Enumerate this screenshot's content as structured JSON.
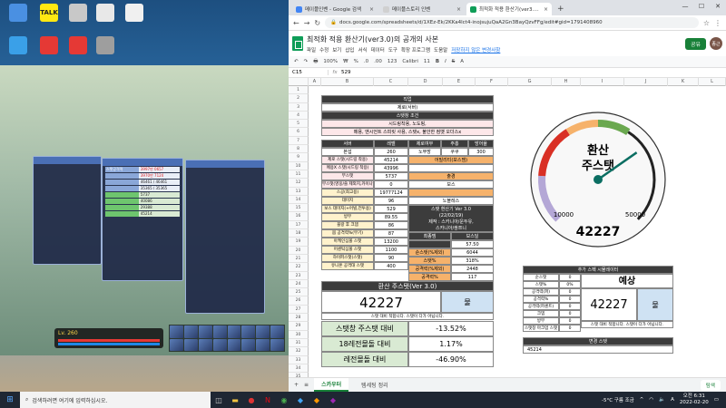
{
  "desktop": {
    "icons": [
      {
        "label": "",
        "color": "#4a90e2"
      },
      {
        "label": "TALK",
        "color": "#ffe812"
      },
      {
        "label": "",
        "color": "#c8c8c8"
      },
      {
        "label": "",
        "color": "#e8e8e8"
      },
      {
        "label": "",
        "color": "#f0f0f0"
      },
      {
        "label": "",
        "color": "#3aa0e8"
      },
      {
        "label": "",
        "color": "#e53935"
      },
      {
        "label": "",
        "color": "#e53935"
      },
      {
        "label": "",
        "color": "#9e9e9e"
      }
    ]
  },
  "game": {
    "level": "Lv. 260",
    "player_name": "",
    "stat_rows": [
      {
        "k": "스탯공격력",
        "v": "3997만 0657"
      },
      {
        "k": "",
        "v": "3970만 7124"
      },
      {
        "k": "",
        "v": "46461 / 46461"
      },
      {
        "k": "",
        "v": "35365 / 35365"
      },
      {
        "k": "",
        "v": "5737"
      },
      {
        "k": "",
        "v": "40086"
      },
      {
        "k": "",
        "v": "29388"
      },
      {
        "k": "",
        "v": "45214"
      }
    ]
  },
  "browser": {
    "tabs": [
      {
        "label": "메이플인벤 - Google 검색",
        "color": "#4285f4",
        "active": false
      },
      {
        "label": "메이플스토리 인벤",
        "color": "#e8e8e8",
        "active": false
      },
      {
        "label": "최적화 적용 환산기(ver3.0)의 공",
        "color": "#0f9d58",
        "active": true
      }
    ],
    "url": "docs.google.com/spreadsheets/d/1XEz-Ek/2KKa4lct4-inojsujuQaA2Gn3BayQzvFFg/edit#gid=1791408960",
    "doc_title": "최적화 적용 환산기(ver3.0)의 공개의 사본",
    "menus": [
      "파일",
      "수정",
      "보기",
      "삽입",
      "서식",
      "데이터",
      "도구",
      "확장 프로그램",
      "도움말"
    ],
    "edit_warning": "저장하지 않은 변경사항",
    "share_label": "공유",
    "avatar_initial": "종근",
    "toolbar": [
      "↶",
      "↷",
      "🖶",
      "100%",
      "₩",
      "%",
      ".0",
      ".00",
      "123",
      "Calibri",
      "11",
      "B",
      "I",
      "S",
      "A"
    ],
    "cell_ref": "C15",
    "formula_value": "529"
  },
  "sheet": {
    "col_headers": [
      "A",
      "B",
      "C",
      "D",
      "E",
      "F",
      "G",
      "H",
      "I",
      "J",
      "K",
      "L"
    ],
    "row_headers": [
      "1",
      "2",
      "3",
      "4",
      "5",
      "6",
      "7",
      "8",
      "9",
      "10",
      "11",
      "12",
      "13",
      "14",
      "15",
      "16",
      "17",
      "18",
      "19",
      "20",
      "21",
      "22",
      "23",
      "24",
      "25",
      "26",
      "27",
      "28",
      "29",
      "30",
      "31",
      "32",
      "33",
      "34",
      "35"
    ],
    "job_label": "직업",
    "job_value": "제로(서버)",
    "spec_label": "스탯창 조건",
    "spec_desc1": "시드링착용, 노도핑,",
    "spec_desc2": "메용, 앤시언트 스피릿 사용, 스탯x, 불안한 컴뱃 오더스x",
    "input_headers": [
      "서버",
      "레벨",
      "제로여부",
      "주홍",
      "방어율"
    ],
    "input_values": [
      "본섭",
      "260",
      "노뚜방",
      "쿠쿠",
      "300"
    ],
    "left_rows": [
      {
        "k": "제로 스탯(시드링 착용)",
        "v": "45214"
      },
      {
        "k": "메용X 스탯(시드링 착용)",
        "v": "43996"
      },
      {
        "k": "부스탯",
        "v": "5737"
      },
      {
        "k": "부스탯(영웅/쓸 제외치,카이나)",
        "v": "0"
      },
      {
        "k": "스공(최고용)",
        "v": "19777124"
      },
      {
        "k": "데미지",
        "v": "96"
      },
      {
        "k": "보스 데미지(+어빌,전투용)",
        "v": "529"
      },
      {
        "k": "방무",
        "v": "89.55"
      },
      {
        "k": "블랑 후 크뎀",
        "v": "86"
      },
      {
        "k": "몹 공격력%(무기)",
        "v": "87"
      },
      {
        "k": "아케인심볼 스탯",
        "v": "13200"
      },
      {
        "k": "어센틱심볼 스탯",
        "v": "1100"
      },
      {
        "k": "하이퍼스탯(스탯)",
        "v": "90"
      },
      {
        "k": "유니온 공격대 스탯",
        "v": "400"
      }
    ],
    "right_labels": {
      "ability_label": "어빌리티(보스뎀)",
      "ability_value": "",
      "union_label": "출경",
      "union_value": "보스",
      "guild_label": "",
      "guild_value": "노블레스"
    },
    "version_box": {
      "title": "스탯 환산기 Ver 3.0",
      "date": "(22/02/19)",
      "maker": "제작 : 스카니아/운두유,",
      "maker2": "스카니아/쌍쯔니"
    },
    "mini_table": [
      {
        "k": "최종뎀",
        "v": "보스딜"
      },
      {
        "k": "",
        "v": "57.50"
      },
      {
        "k": "순스탯(%제외)",
        "v": "6044"
      },
      {
        "k": "스탯%",
        "v": "318%"
      },
      {
        "k": "공격력(%제외)",
        "v": "2448"
      },
      {
        "k": "공격력%",
        "v": "117"
      }
    ],
    "result_title": "환산 주스탯(Ver 3.0)",
    "result_value": "42227",
    "result_unit": "물",
    "result_note": "스탯 대비 적합니다. 스탯이 다가 아닙니다.",
    "compare_rows": [
      {
        "k": "스탯창 주스탯 대비",
        "v": "-13.52%"
      },
      {
        "k": "18레전몰돌 대비",
        "v": "1.17%"
      },
      {
        "k": "레전몰돌 대비",
        "v": "-46.90%"
      }
    ],
    "gauge": {
      "title1": "환산",
      "title2": "주스탯",
      "value": 42227,
      "min_label": "10000",
      "max_label": "50000",
      "value_label": "42227",
      "min": 0,
      "max": 60000
    },
    "sim": {
      "title": "추가 스펙 시뮬레이터",
      "rows": [
        {
          "k": "순스탯",
          "v": "0"
        },
        {
          "k": "스탯%",
          "v": "0%"
        },
        {
          "k": "공격력(퍼)",
          "v": "0"
        },
        {
          "k": "공격력%",
          "v": "0"
        },
        {
          "k": "공격력(퍼센트)",
          "v": "0"
        },
        {
          "k": "크뎀",
          "v": "0"
        },
        {
          "k": "방무",
          "v": "0"
        },
        {
          "k": "스탯창 마크업 스탯",
          "v": "0"
        }
      ],
      "pred_label": "예상",
      "pred_value": "42227",
      "pred_unit": "물",
      "pred_note": "스탯 대비 적합니다. 스탯이 다가 아닙니다.",
      "conv_label": "변경 스탯",
      "conv_value": "45214"
    }
  },
  "sheet_tabs": [
    "스카우터",
    "템세팅 정리"
  ],
  "explore_label": "탐색",
  "taskbar": {
    "search_placeholder": "검색하려면 여기에 입력하십시오.",
    "weather": "-5°C 구름 조금",
    "time": "오전 6:31",
    "date": "2022-02-20"
  }
}
